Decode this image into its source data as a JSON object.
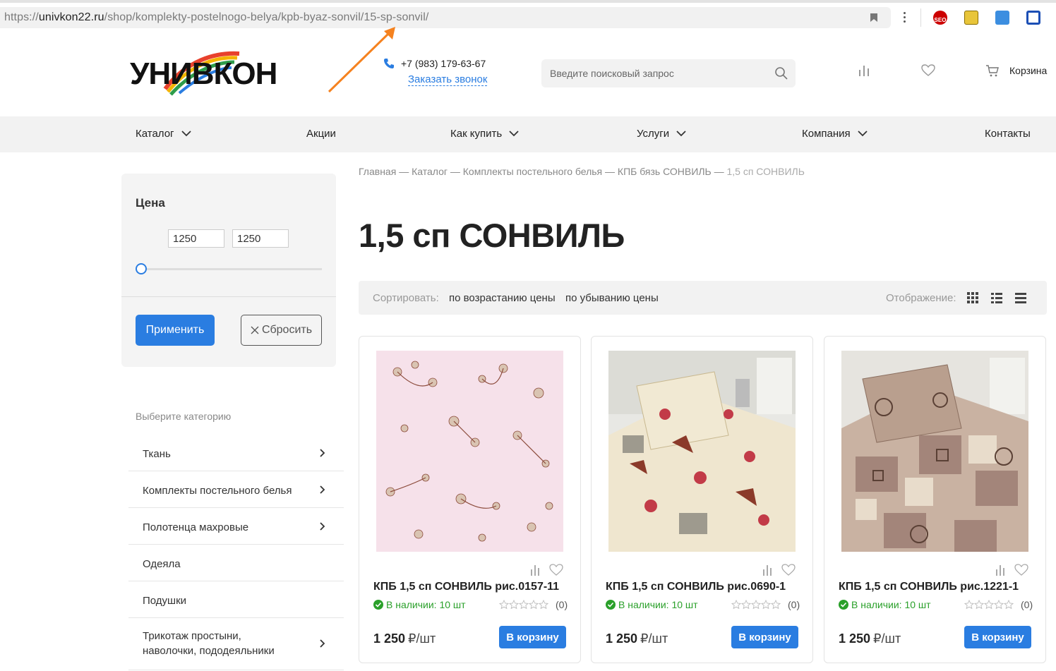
{
  "browser": {
    "url_prefix": "https://",
    "url_domain": "univkon22.ru",
    "url_path": "/shop/komplekty-postelnogo-belya/kpb-byaz-sonvil/15-sp-sonvil/"
  },
  "header": {
    "logo_text": "УНИВКОН",
    "phone": "+7 (983) 179-63-67",
    "callback": "Заказать звонок",
    "search_placeholder": "Введите поисковый запрос",
    "cart_label": "Корзина"
  },
  "nav": {
    "items": [
      {
        "label": "Каталог",
        "has_dropdown": true
      },
      {
        "label": "Акции",
        "has_dropdown": false
      },
      {
        "label": "Как купить",
        "has_dropdown": true
      },
      {
        "label": "Услуги",
        "has_dropdown": true
      },
      {
        "label": "Компания",
        "has_dropdown": true
      },
      {
        "label": "Контакты",
        "has_dropdown": false
      }
    ]
  },
  "filter": {
    "title": "Цена",
    "price_min": "1250",
    "price_max": "1250",
    "apply_label": "Применить",
    "reset_label": "Сбросить"
  },
  "categories": {
    "title": "Выберите категорию",
    "items": [
      {
        "label": "Ткань",
        "has_children": true
      },
      {
        "label": "Комплекты постельного белья",
        "has_children": true
      },
      {
        "label": "Полотенца махровые",
        "has_children": true
      },
      {
        "label": "Одеяла",
        "has_children": false
      },
      {
        "label": "Подушки",
        "has_children": false
      },
      {
        "label": "Трикотаж простыни, наволочки, пододеяльники",
        "has_children": true
      }
    ]
  },
  "breadcrumb": [
    "Главная",
    "Каталог",
    "Комплекты постельного белья",
    "КПБ бязь СОНВИЛЬ",
    "1,5 сп СОНВИЛЬ"
  ],
  "breadcrumb_sep": "—",
  "page_title": "1,5 сп СОНВИЛЬ",
  "sort": {
    "label": "Сортировать:",
    "asc": "по возрастанию цены",
    "desc": "по убыванию цены",
    "view_label": "Отображение:"
  },
  "products": [
    {
      "name": "КПБ 1,5 сп СОНВИЛЬ рис.0157-11",
      "stock": "В наличии: 10 шт",
      "reviews": "(0)",
      "price": "1 250",
      "unit": "₽/шт",
      "buy": "В корзину"
    },
    {
      "name": "КПБ 1,5 сп СОНВИЛЬ рис.0690-1",
      "stock": "В наличии: 10 шт",
      "reviews": "(0)",
      "price": "1 250",
      "unit": "₽/шт",
      "buy": "В корзину"
    },
    {
      "name": "КПБ 1,5 сп СОНВИЛЬ рис.1221-1",
      "stock": "В наличии: 10 шт",
      "reviews": "(0)",
      "price": "1 250",
      "unit": "₽/шт",
      "buy": "В корзину"
    }
  ],
  "colors": {
    "accent": "#2a7de1",
    "in_stock": "#2aa02a",
    "arrow": "#f5821f"
  }
}
